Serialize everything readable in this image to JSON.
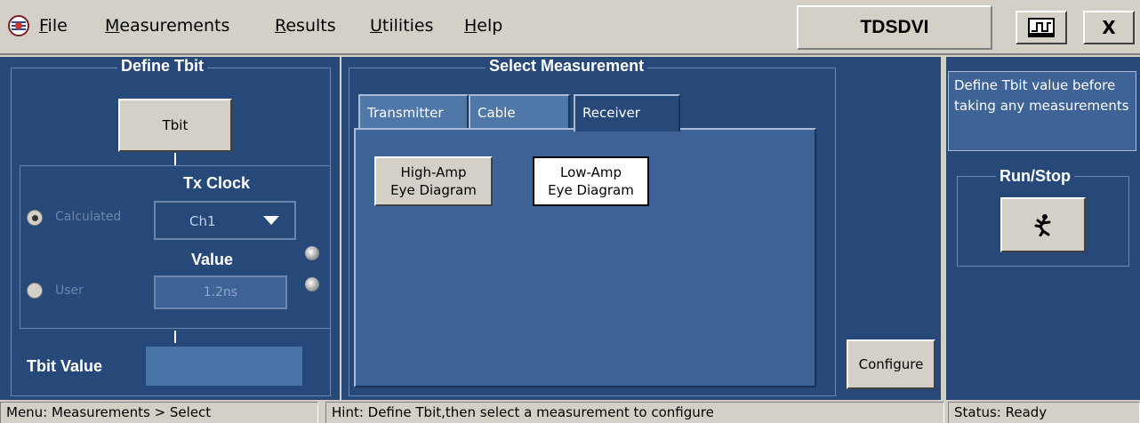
{
  "menu": {
    "items": [
      {
        "pre": "",
        "ul": "F",
        "post": "ile"
      },
      {
        "pre": "",
        "ul": "M",
        "post": "easurements"
      },
      {
        "pre": "",
        "ul": "R",
        "post": "esults"
      },
      {
        "pre": "",
        "ul": "U",
        "post": "tilities"
      },
      {
        "pre": "",
        "ul": "H",
        "post": "elp"
      }
    ],
    "app_title": "TDSDVI",
    "close_label": "X"
  },
  "define_tbit": {
    "title": "Define Tbit",
    "tbit_button": "Tbit",
    "tx_clock_title": "Tx Clock",
    "calculated_label": "Calculated",
    "channel_value": "Ch1",
    "value_title": "Value",
    "user_label": "User",
    "user_value": "1.2ns",
    "tbit_value_label": "Tbit Value",
    "tbit_value": ""
  },
  "select_measurement": {
    "title": "Select Measurement",
    "tabs": [
      "Transmitter",
      "Cable",
      "Receiver"
    ],
    "active_tab": "Receiver",
    "buttons": [
      {
        "line1": "High-Amp",
        "line2": "Eye Diagram"
      },
      {
        "line1": "Low-Amp",
        "line2": "Eye Diagram"
      }
    ]
  },
  "configure_label": "Configure",
  "right_panel": {
    "info_text": "Define Tbit value before taking any measurements",
    "run_stop_title": "Run/Stop"
  },
  "status_bar": {
    "menu_path": "Menu: Measurements > Select",
    "hint": "Hint: Define Tbit,then select a measurement to configure",
    "status": "Status: Ready"
  },
  "colors": {
    "panel_bg": "#27497a",
    "chrome_bg": "#d4d0c8",
    "tab_inactive": "#4f77a8"
  }
}
